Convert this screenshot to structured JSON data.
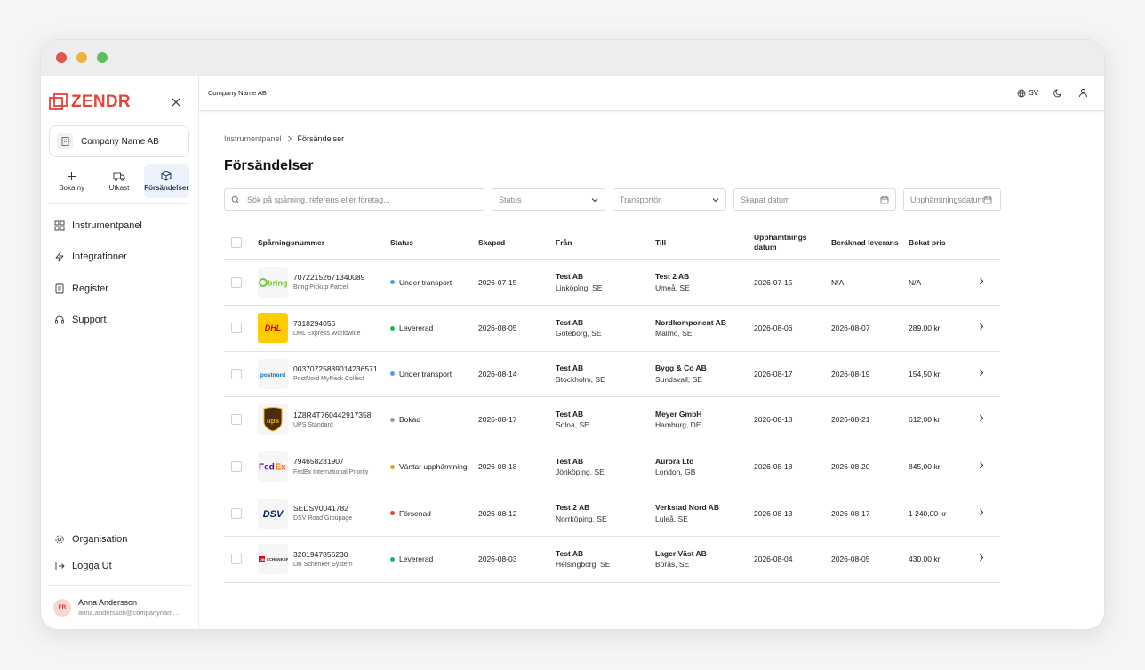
{
  "app": {
    "brand": "ZENDR",
    "brand_color": "#e8423a",
    "company": "Company Name AB"
  },
  "sidebar": {
    "quick_actions": [
      {
        "label": "Boka ny",
        "icon": "plus-icon"
      },
      {
        "label": "Utkast",
        "icon": "truck-icon"
      },
      {
        "label": "Försändelser",
        "icon": "package-icon",
        "active": true
      }
    ],
    "nav": [
      {
        "label": "Instrumentpanel",
        "icon": "dashboard-icon"
      },
      {
        "label": "Integrationer",
        "icon": "lightning-icon"
      },
      {
        "label": "Register",
        "icon": "register-icon"
      },
      {
        "label": "Support",
        "icon": "headset-icon"
      }
    ],
    "bottom_nav": [
      {
        "label": "Organisation",
        "icon": "gear-icon"
      },
      {
        "label": "Logga Ut",
        "icon": "logout-icon"
      }
    ],
    "user": {
      "initials": "FR",
      "name": "Anna Andersson",
      "email": "anna.andersson@companyname.se"
    }
  },
  "topbar": {
    "title": "Company Name AB",
    "language": "SV"
  },
  "page": {
    "breadcrumb": [
      "Instrumentpanel",
      "Försändelser"
    ],
    "title": "Försändelser"
  },
  "filters": {
    "search_placeholder": "Sök på spårning, referens eller företag...",
    "status": "Status",
    "carrier": "Transportör",
    "created_date": "Skapat datum",
    "pickup_date": "Upphämtningsdatum"
  },
  "table": {
    "headers": {
      "tracking": "Spårningsnummer",
      "status": "Status",
      "created": "Skapad",
      "from": "Från",
      "to": "Till",
      "pickup": "Upphämtnings datum",
      "eta": "Beräknad leverans",
      "price": "Bokat pris"
    },
    "rows": [
      {
        "carrier": "bring",
        "tracking": "70722152671340089",
        "service": "Bring Pickup Parcel",
        "status": "Under transport",
        "status_color": "#5b9ee8",
        "created": "2026-07-15",
        "from_name": "Test AB",
        "from_city": "Linköping, SE",
        "to_name": "Test 2 AB",
        "to_city": "Umeå, SE",
        "pickup": "2026-07-15",
        "eta": "N/A",
        "price": "N/A"
      },
      {
        "carrier": "dhl",
        "tracking": "7318294056",
        "service": "DHL Express Worldwide",
        "status": "Levererad",
        "status_color": "#22b45a",
        "created": "2026-08-05",
        "from_name": "Test AB",
        "from_city": "Göteborg, SE",
        "to_name": "Nordkomponent AB",
        "to_city": "Malmö, SE",
        "pickup": "2026-08-06",
        "eta": "2026-08-07",
        "price": "289,00 kr"
      },
      {
        "carrier": "postnord",
        "tracking": "00370725889014236571",
        "service": "PostNord MyPack Collect",
        "status": "Under transport",
        "status_color": "#5b9ee8",
        "created": "2026-08-14",
        "from_name": "Test AB",
        "from_city": "Stockholm, SE",
        "to_name": "Bygg & Co AB",
        "to_city": "Sundsvall, SE",
        "pickup": "2026-08-17",
        "eta": "2026-08-19",
        "price": "154,50 kr"
      },
      {
        "carrier": "ups",
        "tracking": "1Z8R4T760442917358",
        "service": "UPS Standard",
        "status": "Bokad",
        "status_color": "#9a9a9f",
        "created": "2026-08-17",
        "from_name": "Test AB",
        "from_city": "Solna, SE",
        "to_name": "Meyer GmbH",
        "to_city": "Hamburg, DE",
        "pickup": "2026-08-18",
        "eta": "2026-08-21",
        "price": "612,00 kr"
      },
      {
        "carrier": "fedex",
        "tracking": "794658231907",
        "service": "FedEx International Priority",
        "status": "Väntar upphämtning",
        "status_color": "#f0a020",
        "created": "2026-08-18",
        "from_name": "Test AB",
        "from_city": "Jönköping, SE",
        "to_name": "Aurora Ltd",
        "to_city": "London, GB",
        "pickup": "2026-08-18",
        "eta": "2026-08-20",
        "price": "845,00 kr"
      },
      {
        "carrier": "dsv",
        "tracking": "SEDSV0041782",
        "service": "DSV Road Groupage",
        "status": "Försenad",
        "status_color": "#e8423a",
        "created": "2026-08-12",
        "from_name": "Test 2 AB",
        "from_city": "Norrköping, SE",
        "to_name": "Verkstad Nord AB",
        "to_city": "Luleå, SE",
        "pickup": "2026-08-13",
        "eta": "2026-08-17",
        "price": "1 240,00 kr"
      },
      {
        "carrier": "schenker",
        "tracking": "3201947856230",
        "service": "DB Schenker System",
        "status": "Levererad",
        "status_color": "#22b45a",
        "created": "2026-08-03",
        "from_name": "Test AB",
        "from_city": "Helsingborg, SE",
        "to_name": "Lager Väst AB",
        "to_city": "Borås, SE",
        "pickup": "2026-08-04",
        "eta": "2026-08-05",
        "price": "430,00 kr"
      }
    ]
  }
}
